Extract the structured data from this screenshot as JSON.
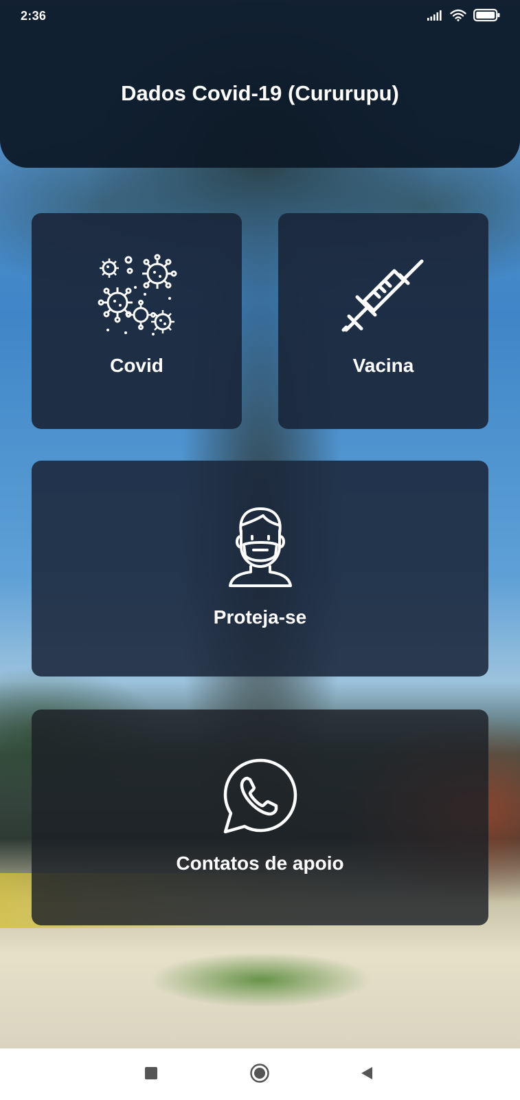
{
  "status_bar": {
    "time": "2:36",
    "icons": [
      "signal-icon",
      "wifi-icon",
      "battery-icon"
    ]
  },
  "header": {
    "title": "Dados Covid-19 (Cururupu)"
  },
  "cards": {
    "covid": {
      "label": "Covid",
      "icon": "virus-icon"
    },
    "vacina": {
      "label": "Vacina",
      "icon": "syringe-icon"
    },
    "proteja": {
      "label": "Proteja-se",
      "icon": "masked-person-icon"
    },
    "contatos": {
      "label": "Contatos de apoio",
      "icon": "whatsapp-icon"
    }
  },
  "nav_bar": {
    "buttons": [
      "recents-square-icon",
      "home-circle-icon",
      "back-triangle-icon"
    ]
  },
  "colors": {
    "header_bg": "#0c1826",
    "card_bg": "#1a263a",
    "text": "#ffffff",
    "nav_bg": "#ffffff",
    "nav_icon": "#555555"
  }
}
